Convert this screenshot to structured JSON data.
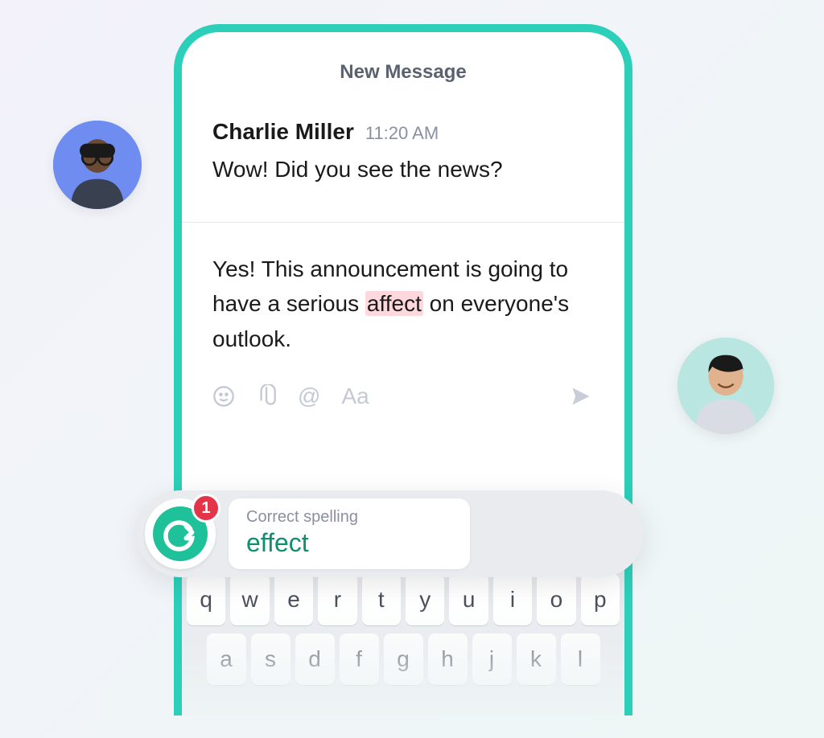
{
  "screen": {
    "title": "New Message"
  },
  "message": {
    "sender_name": "Charlie Miller",
    "timestamp": "11:20 AM",
    "incoming_text": "Wow! Did you see the news?"
  },
  "compose": {
    "text_before": "Yes! This announcement is going to have a serious ",
    "highlighted_word": "affect",
    "text_after": " on everyone's outlook."
  },
  "suggestion": {
    "badge_count": "1",
    "label": "Correct spelling",
    "replacement": "effect"
  },
  "keyboard": {
    "row1": [
      "q",
      "w",
      "e",
      "r",
      "t",
      "y",
      "u",
      "i",
      "o",
      "p"
    ],
    "row2": [
      "a",
      "s",
      "d",
      "f",
      "g",
      "h",
      "j",
      "k",
      "l"
    ]
  },
  "colors": {
    "accent": "#2bcfba",
    "brand_green": "#1fc19a",
    "alert_red": "#e3344a",
    "highlight_bg": "#ffd8dd",
    "suggestion_green": "#0f8f71"
  }
}
